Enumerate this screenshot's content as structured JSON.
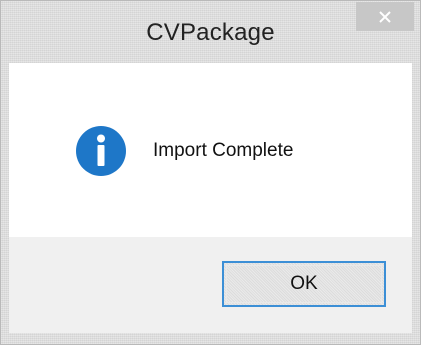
{
  "window": {
    "title": "CVPackage",
    "close_glyph": "✕"
  },
  "message": {
    "icon": "info-icon",
    "text": "Import Complete"
  },
  "buttons": {
    "ok_label": "OK"
  },
  "colors": {
    "info_icon_blue": "#1e77c8",
    "ok_border": "#3c8fd6",
    "close_button_bg": "#c7c7c7"
  }
}
